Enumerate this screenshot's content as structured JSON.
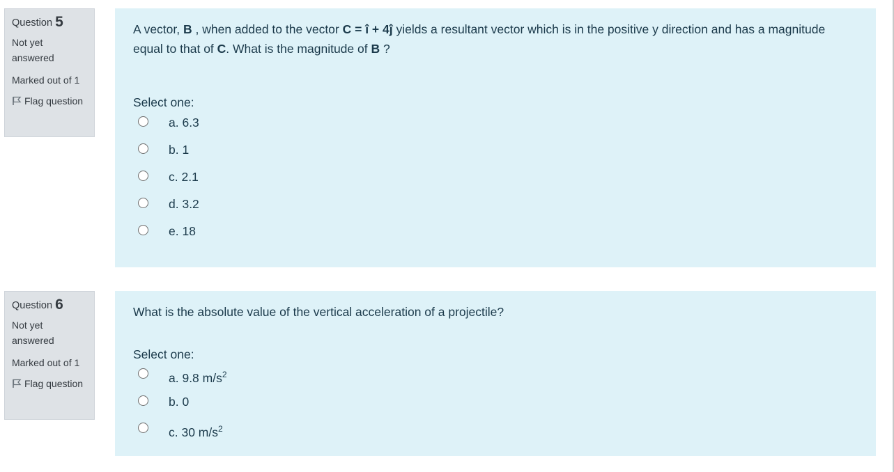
{
  "questions": [
    {
      "label": "Question",
      "number": "5",
      "state": "Not yet answered",
      "grade": "Marked out of 1",
      "flag_label": "Flag question",
      "text_parts": {
        "p1": "A vector, ",
        "b1": "B",
        "p2": " , when added to the vector ",
        "b2": "C = î + 4ĵ",
        "p3": " yields a resultant vector which is in the positive y direction and has a magnitude equal to that of ",
        "b3": "C",
        "p4": ". What is the magnitude of ",
        "b4": "B",
        "p5": " ?"
      },
      "prompt": "Select one:",
      "answers": [
        {
          "text": "a. 6.3"
        },
        {
          "text": "b. 1"
        },
        {
          "text": "c. 2.1"
        },
        {
          "text": "d. 3.2"
        },
        {
          "text": "e. 18"
        }
      ]
    },
    {
      "label": "Question",
      "number": "6",
      "state": "Not yet answered",
      "grade": "Marked out of 1",
      "flag_label": "Flag question",
      "text": "What is the absolute value of the vertical acceleration of a projectile?",
      "prompt": "Select one:",
      "answers": [
        {
          "text": "a. 9.8 m/s",
          "sup": "2"
        },
        {
          "text": "b. 0"
        },
        {
          "text": "c. 30 m/s",
          "sup": "2"
        }
      ]
    }
  ],
  "icons": {
    "flag": "flag-icon",
    "radio": "radio-button"
  },
  "colors": {
    "info_bg": "#dee2e6",
    "content_bg": "#def2f8",
    "text": "#1b3a4b"
  }
}
